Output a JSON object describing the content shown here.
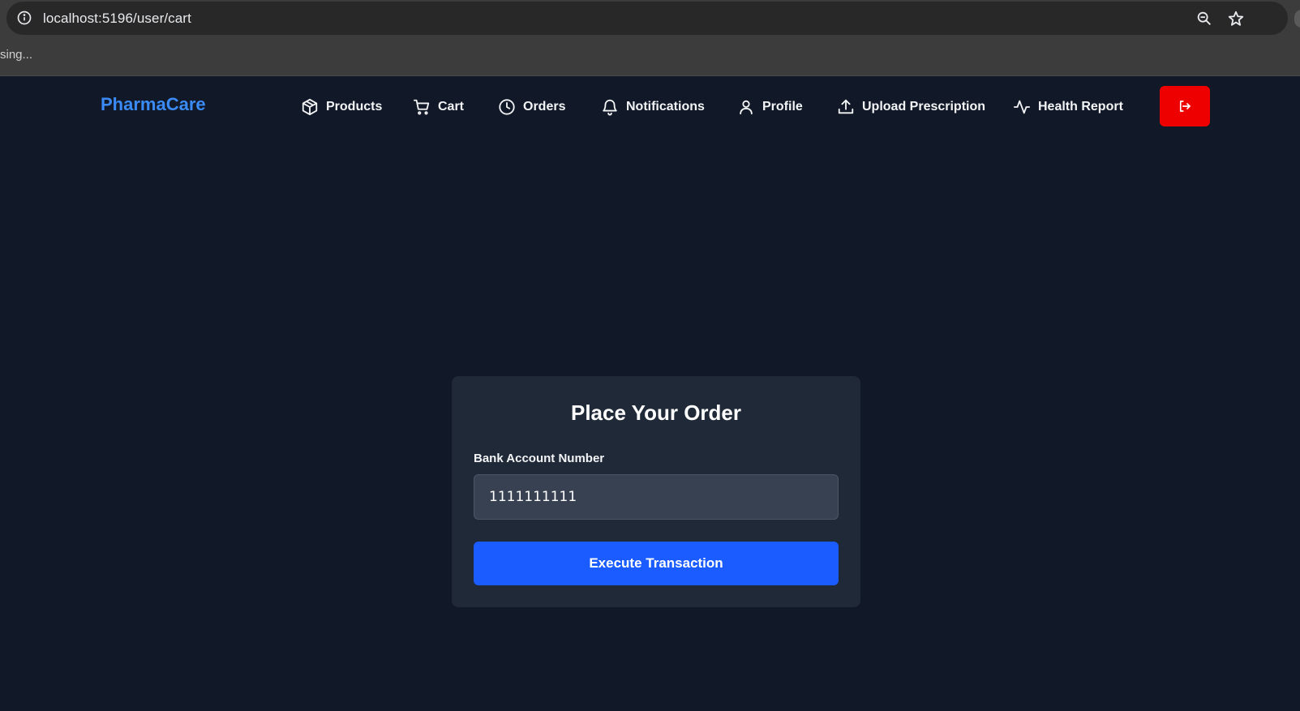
{
  "browser": {
    "url": "localhost:5196/user/cart",
    "status": "sing..."
  },
  "nav": {
    "brand": "PharmaCare",
    "items": [
      {
        "label": "Products",
        "icon": "package-icon"
      },
      {
        "label": "Cart",
        "icon": "cart-icon"
      },
      {
        "label": "Orders",
        "icon": "clock-icon"
      },
      {
        "label": "Notifications",
        "icon": "bell-icon"
      },
      {
        "label": "Profile",
        "icon": "user-icon"
      },
      {
        "label": "Upload Prescription",
        "icon": "upload-icon"
      },
      {
        "label": "Health Report",
        "icon": "activity-icon"
      }
    ],
    "logout_icon": "logout-icon"
  },
  "order": {
    "title": "Place Your Order",
    "account_label": "Bank Account Number",
    "account_value": "1111111111",
    "submit_label": "Execute Transaction"
  },
  "colors": {
    "background": "#111827",
    "card": "#1f2937",
    "brand": "#3b8bf6",
    "primary_button": "#1a5cff",
    "logout_button": "#ee0000"
  }
}
